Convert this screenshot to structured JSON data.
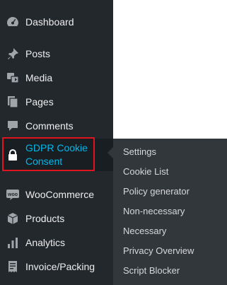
{
  "menu": {
    "dashboard": {
      "label": "Dashboard",
      "icon": "dashboard-icon"
    },
    "posts": {
      "label": "Posts",
      "icon": "pushpin-icon"
    },
    "media": {
      "label": "Media",
      "icon": "media-icon"
    },
    "pages": {
      "label": "Pages",
      "icon": "pages-icon"
    },
    "comments": {
      "label": "Comments",
      "icon": "comment-icon"
    },
    "gdpr": {
      "label": "GDPR Cookie Consent",
      "icon": "lock-icon"
    },
    "woocommerce": {
      "label": "WooCommerce",
      "icon": "woo-icon"
    },
    "products": {
      "label": "Products",
      "icon": "box-icon"
    },
    "analytics": {
      "label": "Analytics",
      "icon": "bar-chart-icon"
    },
    "invoice": {
      "label": "Invoice/Packing",
      "icon": "invoice-icon"
    }
  },
  "submenu": {
    "items": [
      "Settings",
      "Cookie List",
      "Policy generator",
      "Non-necessary",
      "Necessary",
      "Privacy Overview",
      "Script Blocker"
    ]
  },
  "colors": {
    "sidebar_bg": "#23282d",
    "submenu_bg": "#32373c",
    "active_text": "#00b9eb",
    "highlight_border": "#e0141e",
    "text": "#eeeeee"
  }
}
